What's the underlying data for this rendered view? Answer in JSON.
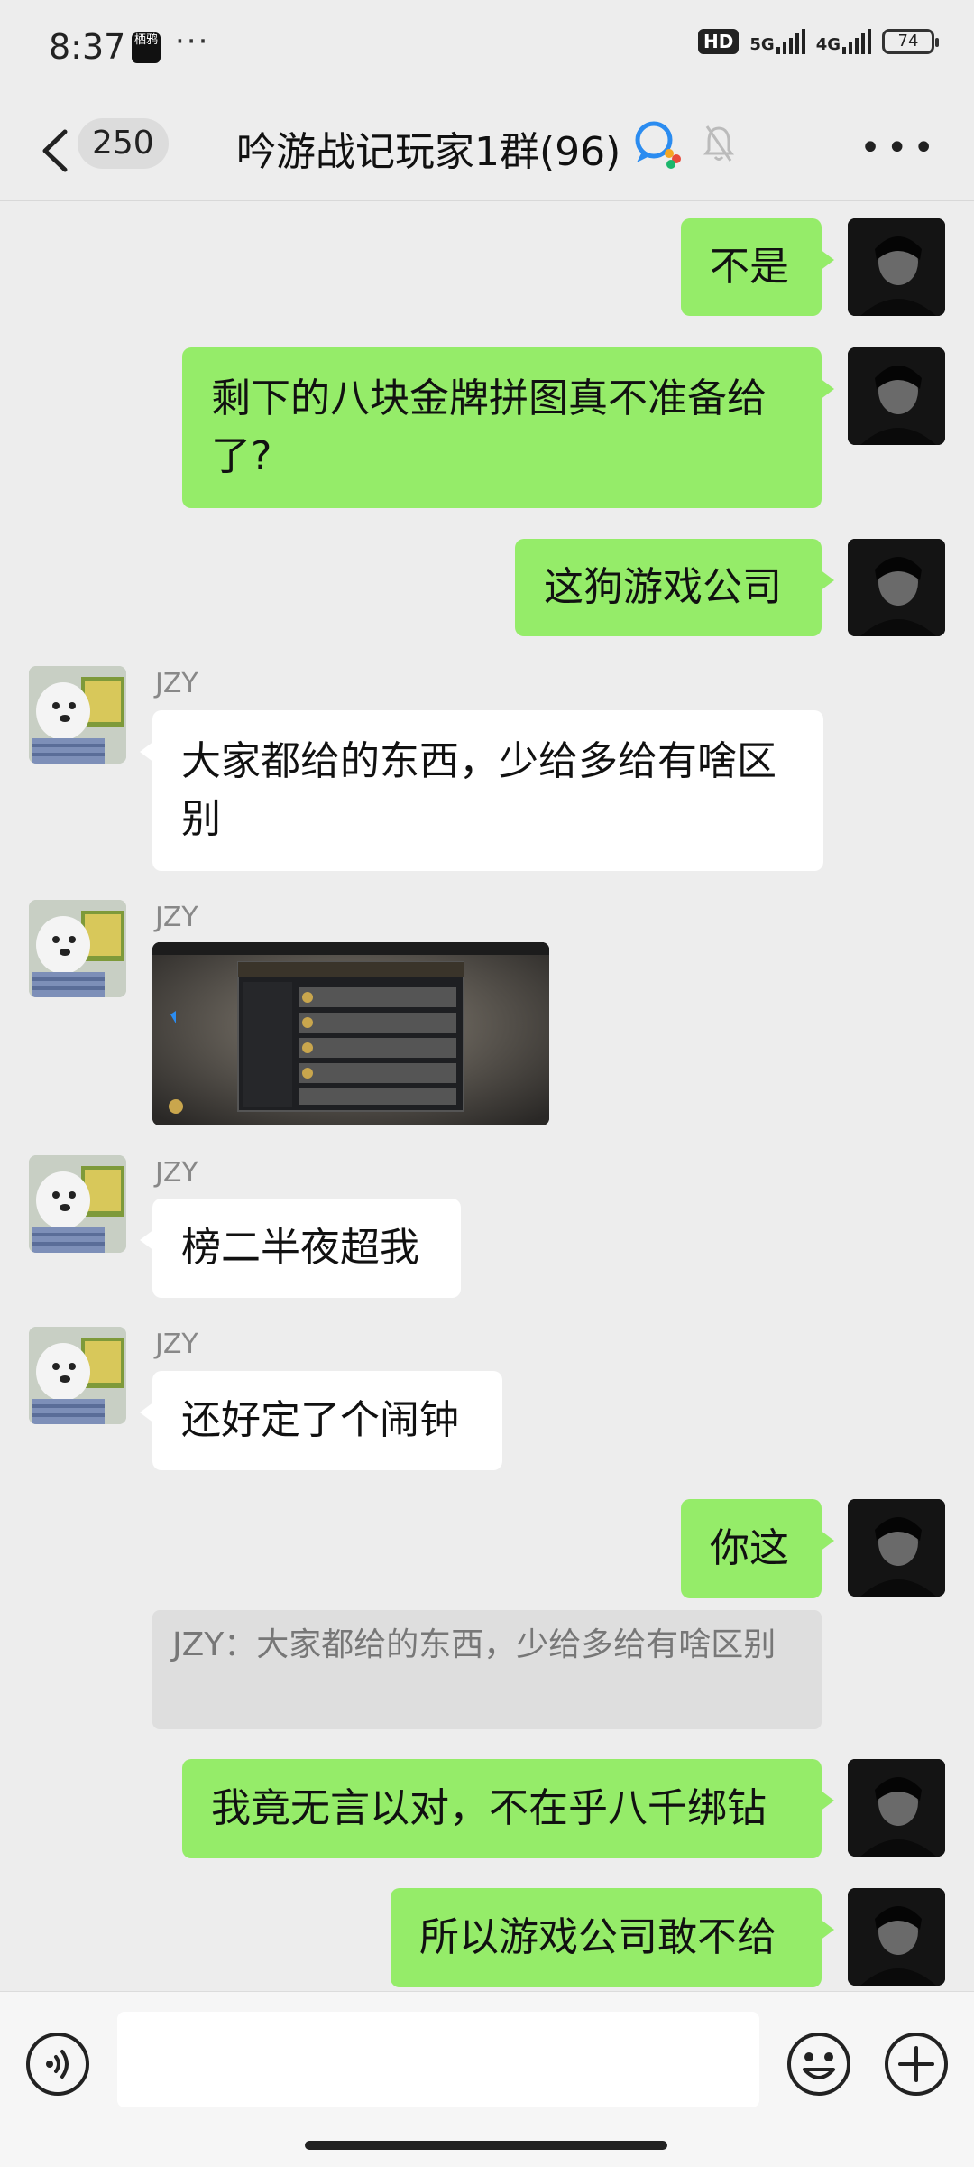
{
  "status_bar": {
    "time": "8:37",
    "app_badge": "栖鸦",
    "dots": "···",
    "hd": "HD",
    "net1": "5G",
    "net2": "4G",
    "battery": "74"
  },
  "header": {
    "unread_count": "250",
    "title": "吟游战记玩家1群(96)"
  },
  "messages": [
    {
      "side": "right",
      "text": "不是"
    },
    {
      "side": "right",
      "text": "剩下的八块金牌拼图真不准备给了?"
    },
    {
      "side": "right",
      "text": "这狗游戏公司"
    },
    {
      "side": "left",
      "sender": "JZY",
      "text": "大家都给的东西，少给多给有啥区别"
    },
    {
      "side": "left",
      "sender": "JZY",
      "type": "image"
    },
    {
      "side": "left",
      "sender": "JZY",
      "text": "榜二半夜超我"
    },
    {
      "side": "left",
      "sender": "JZY",
      "text": "还好定了个闹钟"
    },
    {
      "side": "right",
      "text": "你这",
      "quote": "JZY：大家都给的东西，少给多给有啥区别"
    },
    {
      "side": "right",
      "text": "我竟无言以对，不在乎八千绑钻"
    },
    {
      "side": "right",
      "text": "所以游戏公司敢不给"
    }
  ],
  "input": {
    "placeholder": ""
  },
  "colors": {
    "bubble_self": "#95ec69",
    "bubble_other": "#ffffff",
    "background": "#ededed"
  }
}
